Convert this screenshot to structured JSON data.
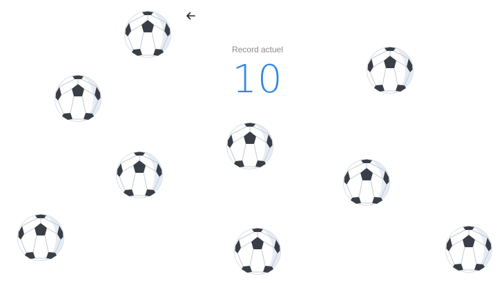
{
  "header": {
    "back_icon": "arrow-left-icon"
  },
  "score": {
    "label": "Record actuel",
    "value": "10",
    "color": "#2f89e0"
  },
  "balls": {
    "icon": "soccer-ball-icon",
    "count": 9
  }
}
